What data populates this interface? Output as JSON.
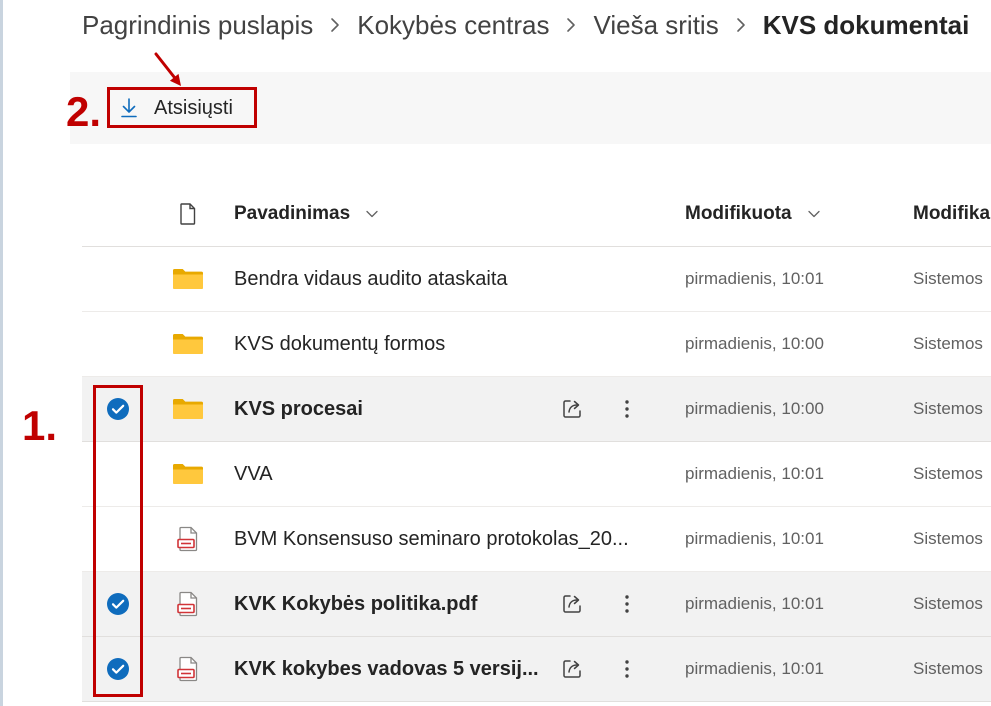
{
  "breadcrumb": {
    "items": [
      "Pagrindinis puslapis",
      "Kokybės centras",
      "Vieša sritis",
      "KVS dokumentai"
    ],
    "separator_icon": "chevron-right-icon"
  },
  "command_bar": {
    "download": {
      "label": "Atsisiųsti",
      "icon": "download-icon"
    }
  },
  "annotations": {
    "step_1": "1.",
    "step_2": "2."
  },
  "columns": {
    "type_icon": "file-icon",
    "name": "Pavadinimas",
    "modified": "Modifikuota",
    "modified_by": "Modifika",
    "sort_icon": "chevron-down-icon"
  },
  "rows": [
    {
      "icon": "folder-icon",
      "name": "Bendra vidaus audito ataskaita",
      "modified": "pirmadienis, 10:01",
      "modified_by": "Sistemos",
      "selected": false
    },
    {
      "icon": "folder-icon",
      "name": "KVS dokumentų formos",
      "modified": "pirmadienis, 10:00",
      "modified_by": "Sistemos",
      "selected": false
    },
    {
      "icon": "folder-icon",
      "name": "KVS procesai",
      "modified": "pirmadienis, 10:00",
      "modified_by": "Sistemos",
      "selected": true
    },
    {
      "icon": "folder-icon",
      "name": "VVA",
      "modified": "pirmadienis, 10:01",
      "modified_by": "Sistemos",
      "selected": false
    },
    {
      "icon": "pdf-icon",
      "name": "BVM Konsensuso seminaro protokolas_20...",
      "modified": "pirmadienis, 10:01",
      "modified_by": "Sistemos",
      "selected": false
    },
    {
      "icon": "pdf-icon",
      "name": "KVK Kokybės politika.pdf",
      "modified": "pirmadienis, 10:01",
      "modified_by": "Sistemos",
      "selected": true
    },
    {
      "icon": "pdf-icon",
      "name": "KVK kokybes vadovas 5 versij...",
      "modified": "pirmadienis, 10:01",
      "modified_by": "Sistemos",
      "selected": true
    }
  ],
  "colors": {
    "accent": "#0f6cbd",
    "annotation": "#c00000",
    "selected_row": "#f2f2f2",
    "folder": "#ffc83d",
    "pdf": "#d13438"
  }
}
